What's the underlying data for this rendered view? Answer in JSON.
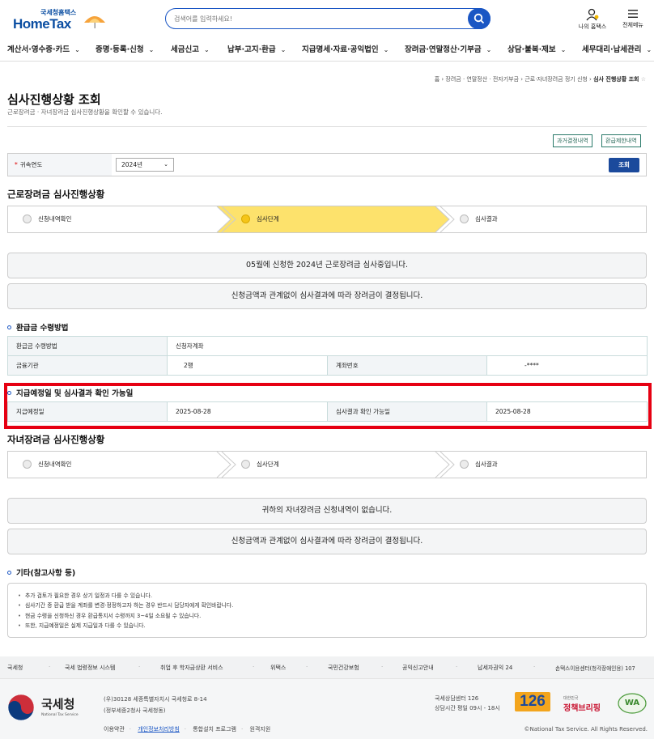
{
  "header": {
    "logo_sub": "국세청홈택스",
    "logo_main": "HomeTax",
    "search_placeholder": "검색어를 입력하세요!",
    "my_home_label": "나의 홈택스",
    "all_menu_label": "전체메뉴"
  },
  "gnb": [
    {
      "label": "계산서·영수증·카드"
    },
    {
      "label": "증명·등록·신청"
    },
    {
      "label": "세금신고"
    },
    {
      "label": "납부·고지·환급"
    },
    {
      "label": "지급명세·자료·공익법인"
    },
    {
      "label": "장려금·연말정산·기부금"
    },
    {
      "label": "상담·불복·제보"
    },
    {
      "label": "세무대리·납세관리"
    }
  ],
  "breadcrumb": [
    "홈",
    "장려금 · 연말정산 · 전자기부금",
    "근로·자녀장려금 정기 신청",
    "심사 진행상황 조회"
  ],
  "page": {
    "title": "심사진행상황 조회",
    "desc": "근로장려금 · 자녀장려금 심사진행상황을 확인할 수 있습니다.",
    "btn_past": "과거결정내역",
    "btn_limit": "환급제한내역"
  },
  "filter": {
    "label": "귀속연도",
    "required_mark": "*",
    "year_value": "2024년",
    "submit_label": "조회"
  },
  "earned": {
    "title": "근로장려금 심사진행상황",
    "steps": [
      "신청내역확인",
      "심사단계",
      "심사결과"
    ],
    "active_step": 1,
    "msg1": "05월에 신청한 2024년 근로장려금 심사중입니다.",
    "msg2": "신청금액과 관계없이 심사결과에 따라 장려금이 결정됩니다."
  },
  "refund": {
    "title": "환급금 수령방법",
    "method_label": "환급금 수령방법",
    "method_value": "신청자계좌",
    "bank_label": "금융기관",
    "bank_value": "2행",
    "account_label": "계좌번호",
    "account_value": "-****"
  },
  "schedule": {
    "title": "지급예정일 및 심사결과 확인 가능일",
    "pay_date_label": "지급예정일",
    "pay_date_value": "2025-08-28",
    "result_date_label": "심사결과 확인 가능일",
    "result_date_value": "2025-08-28"
  },
  "child": {
    "title": "자녀장려금 심사진행상황",
    "steps": [
      "신청내역확인",
      "심사단계",
      "심사결과"
    ],
    "msg1": "귀하의 자녀장려금 신청내역이 없습니다.",
    "msg2": "신청금액과 관계없이 심사결과에 따라 장려금이 결정됩니다."
  },
  "notes": {
    "title": "기타(참고사항 등)",
    "items": [
      "추가 검토가 필요한 경우 상기 일정과 다를 수 있습니다.",
      "심사기간 중 환급 받을 계좌를 변경·정정하고자 하는 경우 반드시 담당자에게 확인바랍니다.",
      "현금 수령을 신청하신 경우 환급통지서 수령까지 3~4일 소요될 수 있습니다.",
      "또한, 지급예정일은 실제 지급일과 다를 수 있습니다."
    ]
  },
  "footer": {
    "links": [
      "국세청",
      "국세 법령정보 시스템",
      "취업 후 학자금상환 서비스",
      "위택스",
      "국민건강보험",
      "공익신고안내",
      "납세자권익 24",
      "손택스이용센터(청각장애인용) 107"
    ],
    "org_name": "국세청",
    "org_en": "National Tax Service",
    "address1": "(우)30128 세종특별자치시 국세청로 8-14",
    "address2": "(정부세종2청사 국세청동)",
    "center1": "국세상담센터 126",
    "center2": "상담시간 평일 09시 - 18시",
    "badge": "126",
    "policy_small": "대한민국",
    "policy_big": "정책브리핑",
    "wa": "WA",
    "bottom_links": [
      "이용약관",
      "개인정보처리방침",
      "통합설치 프로그램",
      "원격지원"
    ],
    "copyright": "©National Tax Service. All Rights Reserved."
  },
  "colors": {
    "brand": "#0b4ea2",
    "accent": "#1a56c4",
    "highlight": "#e60012",
    "active_step": "#fde26c"
  }
}
